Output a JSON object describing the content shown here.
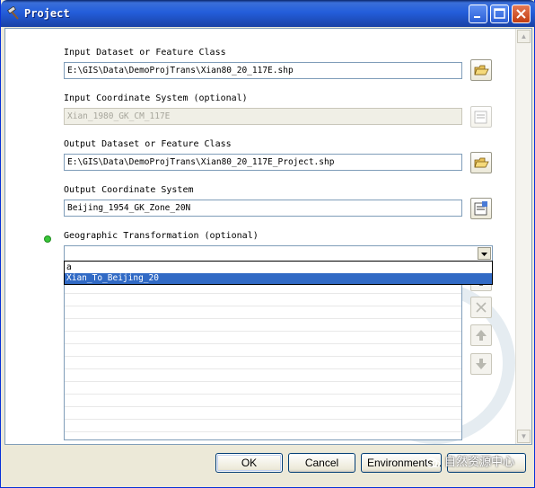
{
  "window": {
    "title": "Project"
  },
  "form": {
    "input_dataset": {
      "label": "Input Dataset or Feature Class",
      "value": "E:\\GIS\\Data\\DemoProjTrans\\Xian80_20_117E.shp"
    },
    "input_coord": {
      "label": "Input Coordinate System (optional)",
      "value": "Xian_1980_GK_CM_117E"
    },
    "output_dataset": {
      "label": "Output Dataset or Feature Class",
      "value": "E:\\GIS\\Data\\DemoProjTrans\\Xian80_20_117E_Project.shp"
    },
    "output_coord": {
      "label": "Output Coordinate System",
      "value": "Beijing_1954_GK_Zone_20N"
    },
    "geo_transform": {
      "label": "Geographic Transformation (optional)",
      "combo_value": "",
      "dropdown_items": [
        "a",
        "Xian_To_Beijing_20"
      ],
      "selected_index": 1
    }
  },
  "buttons": {
    "ok": "OK",
    "cancel": "Cancel",
    "environments": "Environments..."
  },
  "watermark": "自然资源中心",
  "colors": {
    "title_bar": "#245edb",
    "selection": "#316ac5",
    "required_dot": "#39c639"
  }
}
